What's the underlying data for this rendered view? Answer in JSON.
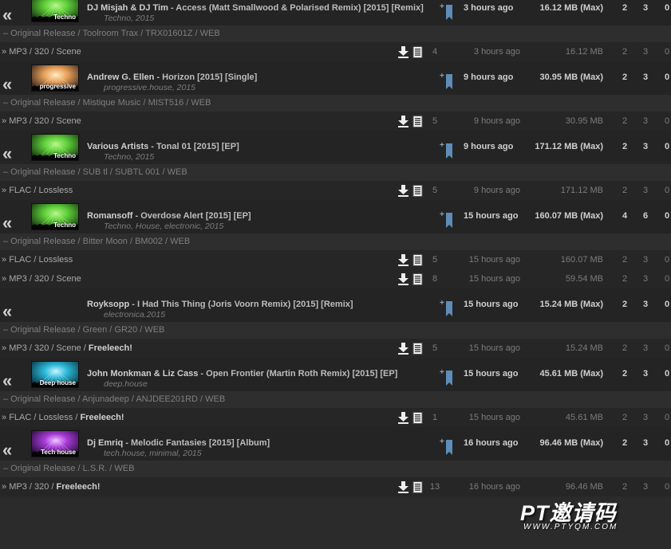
{
  "groups": [
    {
      "artist": "DJ Misjah & DJ Tim",
      "title": " - Access (Matt Smallwood & Polarised Remix) [2015] [Remix]",
      "tags": [
        "Techno",
        "2015"
      ],
      "thumb_label": "Techno",
      "thumb_colors": [
        "#0b1f0a",
        "#5fd03a",
        "#b6f58a"
      ],
      "added": "3 hours ago",
      "size": "16.12 MB (Max)",
      "seeders": "2",
      "snatches": "3",
      "leechers": "0",
      "edition": "– Original Release / Toolroom Trax / TRX01601Z / WEB",
      "formats": [
        {
          "label": "MP3 / 320 / Scene",
          "freeleech": "",
          "files": "4",
          "time": "3 hours ago",
          "size": "16.12 MB",
          "snatches": "2",
          "seeders": "3",
          "leechers": "0"
        }
      ]
    },
    {
      "artist": "Andrew G. Ellen",
      "title": " - Horizon [2015] [Single]",
      "tags": [
        "progressive.house",
        "2015"
      ],
      "thumb_label": "progressive",
      "thumb_colors": [
        "#1a1014",
        "#e8a25a",
        "#ffe9c0"
      ],
      "added": "9 hours ago",
      "size": "30.95 MB (Max)",
      "seeders": "2",
      "snatches": "3",
      "leechers": "0",
      "edition": "– Original Release / Mistique Music / MIST516 / WEB",
      "formats": [
        {
          "label": "MP3 / 320 / Scene",
          "freeleech": "",
          "files": "5",
          "time": "9 hours ago",
          "size": "30.95 MB",
          "snatches": "2",
          "seeders": "3",
          "leechers": "0"
        }
      ]
    },
    {
      "artist": "Various Artists",
      "title": " - Tonal 01 [2015] [EP]",
      "tags": [
        "Techno",
        "2015"
      ],
      "thumb_label": "Techno",
      "thumb_colors": [
        "#0b1f0a",
        "#5fd03a",
        "#b6f58a"
      ],
      "added": "9 hours ago",
      "size": "171.12 MB (Max)",
      "seeders": "2",
      "snatches": "3",
      "leechers": "0",
      "edition": "– Original Release / SUB tl / SUBTL 001 / WEB",
      "formats": [
        {
          "label": "FLAC / Lossless",
          "freeleech": "",
          "files": "5",
          "time": "9 hours ago",
          "size": "171.12 MB",
          "snatches": "2",
          "seeders": "3",
          "leechers": "0"
        }
      ]
    },
    {
      "artist": "Romansoff",
      "title": " - Overdose Alert [2015] [EP]",
      "tags": [
        "Techno",
        "House",
        "electronic",
        "2015"
      ],
      "thumb_label": "Techno",
      "thumb_colors": [
        "#0b1f0a",
        "#5fd03a",
        "#b6f58a"
      ],
      "added": "15 hours ago",
      "size": "160.07 MB (Max)",
      "seeders": "4",
      "snatches": "6",
      "leechers": "0",
      "edition": "– Original Release / Bitter Moon / BM002 / WEB",
      "formats": [
        {
          "label": "FLAC / Lossless",
          "freeleech": "",
          "files": "5",
          "time": "15 hours ago",
          "size": "160.07 MB",
          "snatches": "2",
          "seeders": "3",
          "leechers": "0"
        },
        {
          "label": "MP3 / 320 / Scene",
          "freeleech": "",
          "files": "8",
          "time": "15 hours ago",
          "size": "59.54 MB",
          "snatches": "2",
          "seeders": "3",
          "leechers": "0"
        }
      ]
    },
    {
      "artist": "Royksopp",
      "title": " - I Had This Thing (Joris Voorn Remix) [2015] [Remix]",
      "tags": [
        "electronica.2015"
      ],
      "thumb_label": "",
      "thumb_colors": [],
      "added": "15 hours ago",
      "size": "15.24 MB (Max)",
      "seeders": "2",
      "snatches": "3",
      "leechers": "0",
      "edition": "– Original Release / Green / GR20 / WEB",
      "formats": [
        {
          "label": "MP3 / 320 / Scene / ",
          "freeleech": "Freeleech!",
          "files": "5",
          "time": "15 hours ago",
          "size": "15.24 MB",
          "snatches": "2",
          "seeders": "3",
          "leechers": "0"
        }
      ]
    },
    {
      "artist": "John Monkman & Liz Cass",
      "title": " - Open Frontier (Martin Roth Remix) [2015] [EP]",
      "tags": [
        "deep.house"
      ],
      "thumb_label": "Deep house",
      "thumb_colors": [
        "#04202c",
        "#2ab7d6",
        "#c5f2ff"
      ],
      "added": "15 hours ago",
      "size": "45.61 MB (Max)",
      "seeders": "2",
      "snatches": "3",
      "leechers": "0",
      "edition": "– Original Release / Anjunadeep / ANJDEE201RD / WEB",
      "formats": [
        {
          "label": "FLAC / Lossless / ",
          "freeleech": "Freeleech!",
          "files": "1",
          "time": "15 hours ago",
          "size": "45.61 MB",
          "snatches": "2",
          "seeders": "3",
          "leechers": "0"
        }
      ]
    },
    {
      "artist": "Dj Emriq",
      "title": " - Melodic Fantasies [2015] [Album]",
      "tags": [
        "tech.house",
        "minimal",
        "2015"
      ],
      "thumb_label": "Tech house",
      "thumb_colors": [
        "#12041e",
        "#a53ad6",
        "#f0c0ff"
      ],
      "added": "16 hours ago",
      "size": "96.46 MB (Max)",
      "seeders": "2",
      "snatches": "3",
      "leechers": "0",
      "edition": "– Original Release / L.S.R. / WEB",
      "formats": [
        {
          "label": "MP3 / 320 / ",
          "freeleech": "Freeleech!",
          "files": "13",
          "time": "16 hours ago",
          "size": "96.46 MB",
          "snatches": "2",
          "seeders": "3",
          "leechers": "0"
        }
      ]
    }
  ],
  "icons": {
    "collapse": "«",
    "add": "+",
    "bookmark": "bookmark-icon",
    "download": "download-icon",
    "nfo": "nfo-icon"
  },
  "watermark": {
    "logo": "PT邀请码",
    "url": "WWW.PTYQM.COM"
  }
}
